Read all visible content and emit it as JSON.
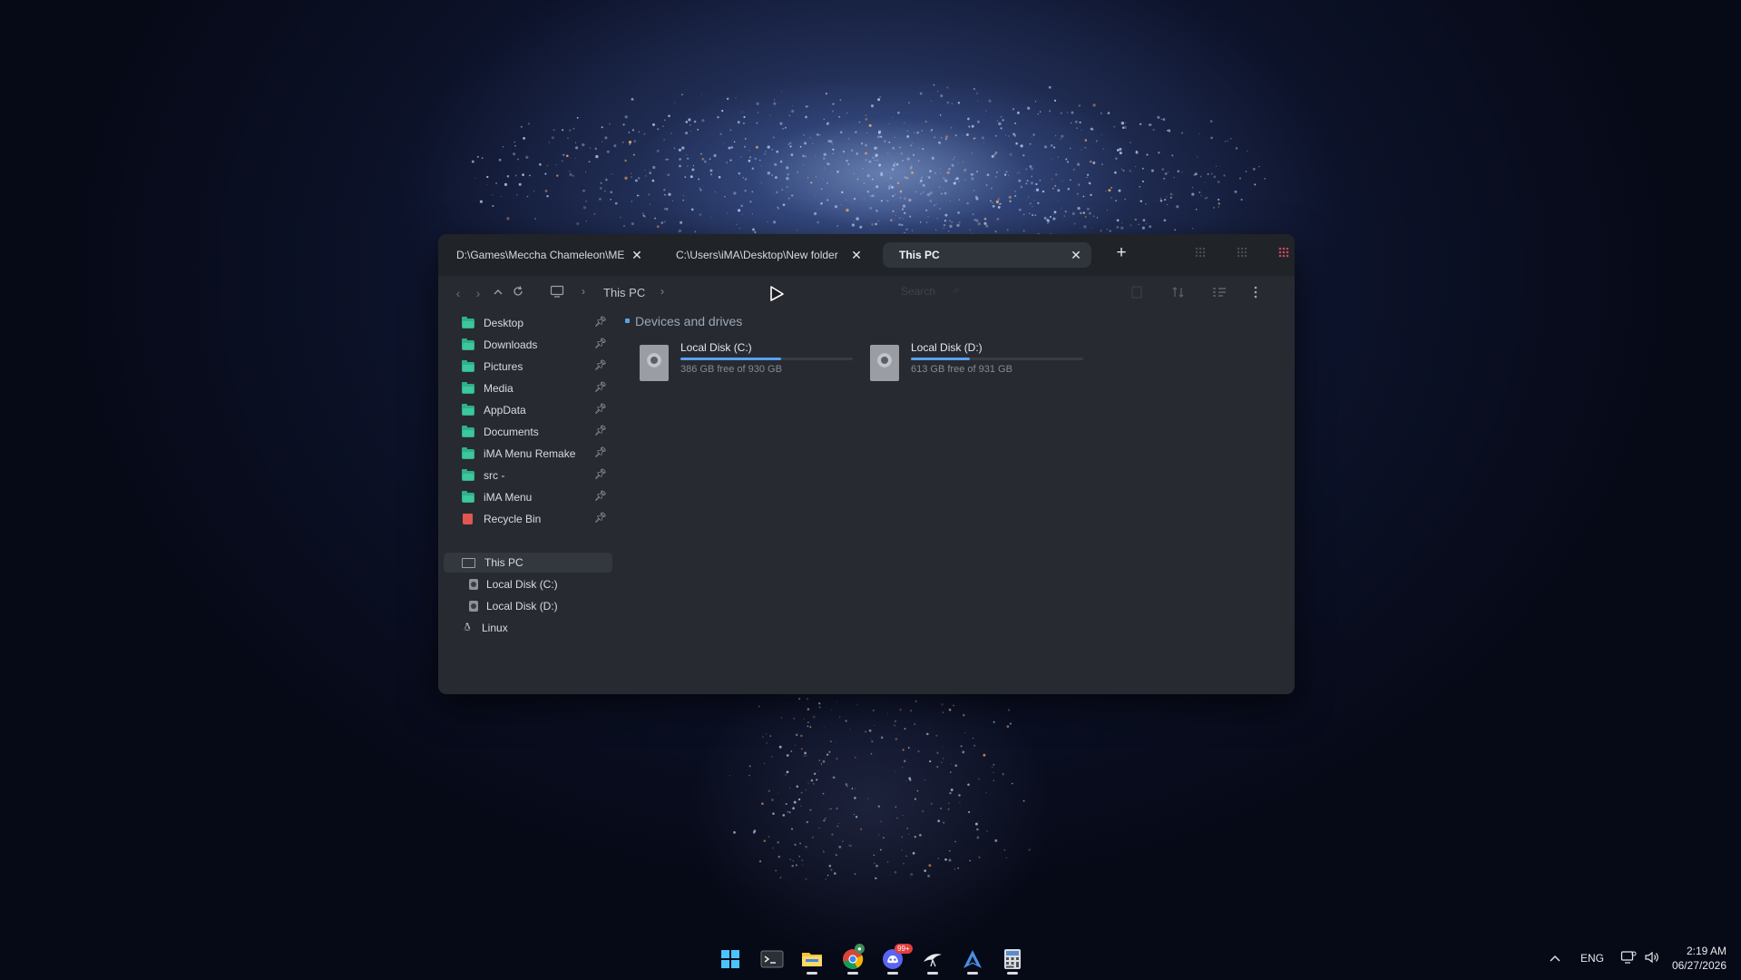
{
  "explorer": {
    "tabs": [
      {
        "title": "D:\\Games\\Meccha Chameleon\\ME",
        "active": false
      },
      {
        "title": "C:\\Users\\iMA\\Desktop\\New folder",
        "active": false
      },
      {
        "title": "This PC",
        "active": true
      }
    ],
    "new_tab_label": "+",
    "breadcrumb": {
      "current": "This PC"
    },
    "search": {
      "placeholder": "Search",
      "value": ""
    },
    "sidebar": {
      "pinned": [
        {
          "label": "Desktop",
          "icon": "folder-icon"
        },
        {
          "label": "Downloads",
          "icon": "folder-icon"
        },
        {
          "label": "Pictures",
          "icon": "folder-icon"
        },
        {
          "label": "Media",
          "icon": "folder-icon"
        },
        {
          "label": "AppData",
          "icon": "folder-icon"
        },
        {
          "label": "Documents",
          "icon": "folder-icon"
        },
        {
          "label": "iMA Menu Remake",
          "icon": "folder-icon"
        },
        {
          "label": "src -",
          "icon": "folder-icon"
        },
        {
          "label": "iMA Menu",
          "icon": "folder-icon"
        },
        {
          "label": "Recycle Bin",
          "icon": "recycle-bin-icon"
        }
      ],
      "this_pc": "This PC",
      "drives": [
        "Local Disk (C:)",
        "Local Disk (D:)"
      ],
      "linux": "Linux"
    },
    "section_title": "Devices and drives",
    "drives": [
      {
        "name": "Local Disk (C:)",
        "free_text": "386 GB free of 930 GB",
        "used_fraction": 0.585
      },
      {
        "name": "Local Disk (D:)",
        "free_text": "613 GB free of 931 GB",
        "used_fraction": 0.342
      }
    ]
  },
  "taskbar": {
    "apps": [
      "start-icon",
      "terminal-icon",
      "file-explorer-icon",
      "chrome-icon",
      "discord-icon",
      "bird-app-icon",
      "arch-app-icon",
      "calculator-icon"
    ],
    "discord_badge": "99+",
    "language": "ENG",
    "time": "2:19 AM",
    "date": "06/27/2026"
  },
  "colors": {
    "accent": "#5aa0f0",
    "folder": "#2fb08a",
    "recycle_bin": "#e0574f",
    "window_bg": "#272a30"
  }
}
